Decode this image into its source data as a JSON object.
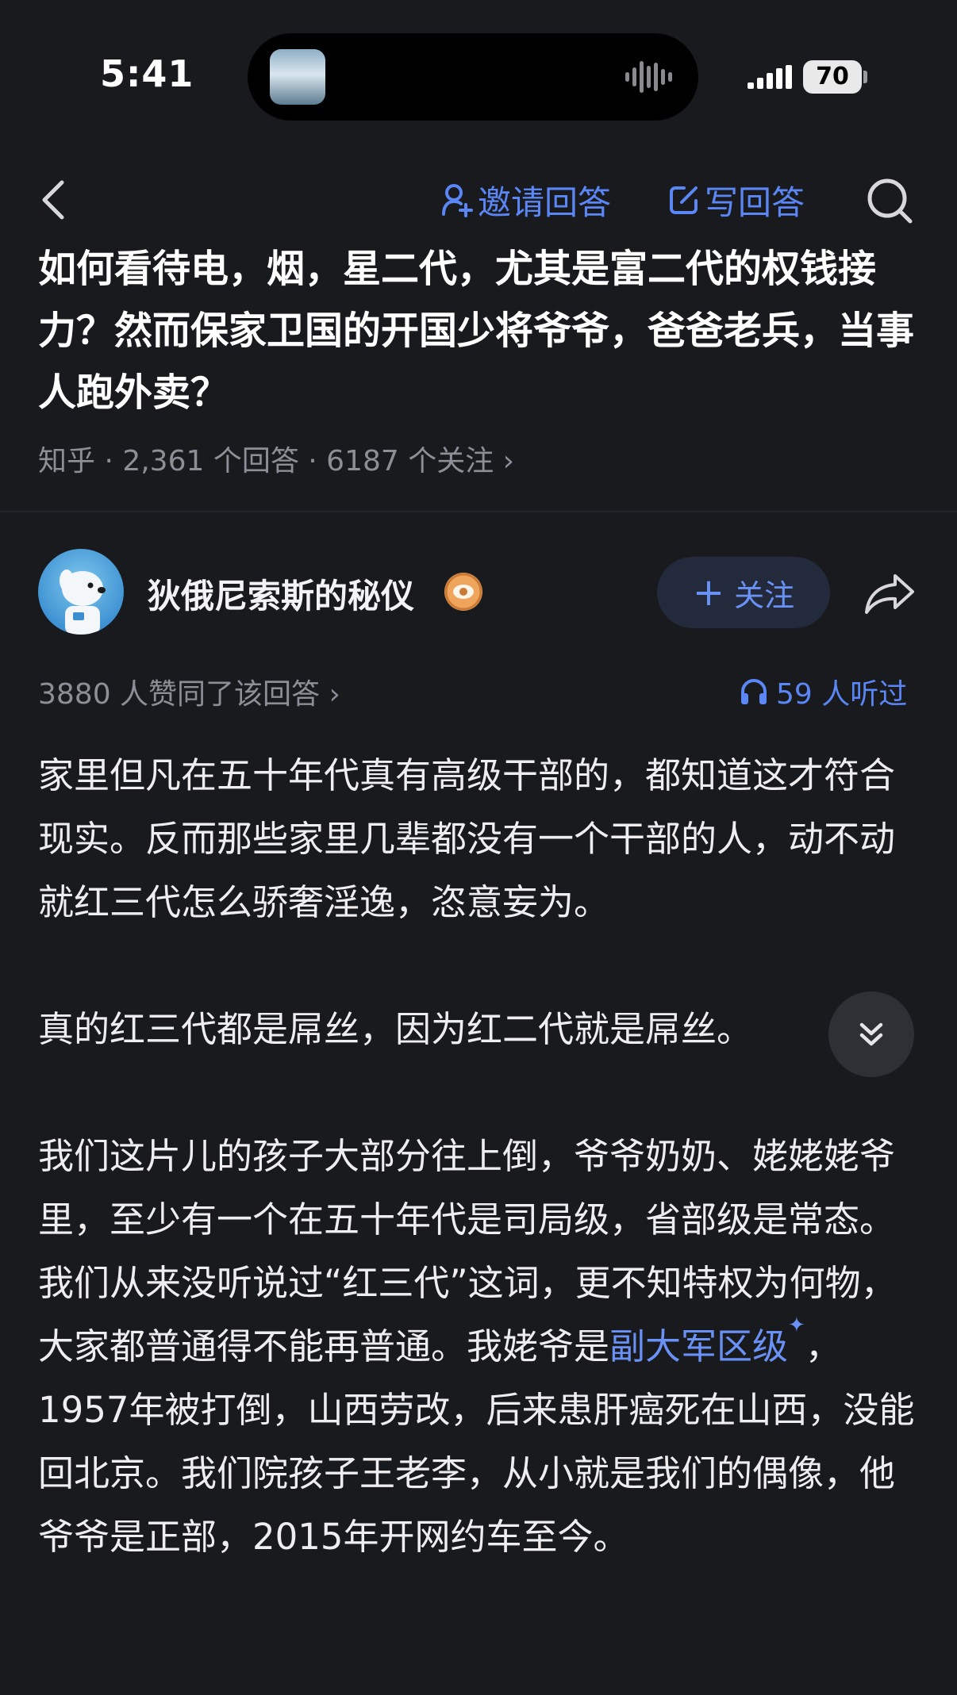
{
  "status": {
    "time": "5:41",
    "battery": "70"
  },
  "nav": {
    "invite_label": "邀请回答",
    "write_label": "写回答"
  },
  "question": {
    "title": "如何看待电，烟，星二代，尤其是富二代的权钱接力？然而保家卫国的开国少将爷爷，爸爸老兵，当事人跑外卖？",
    "meta": "知乎 · 2,361 个回答 · 6187 个关注 ›"
  },
  "answer": {
    "author_name": "狄俄尼索斯的秘仪",
    "follow_label": "关注",
    "follow_plus": "+",
    "agree_text": "3880 人赞同了该回答 ›",
    "listen_text": "59 人听过",
    "paragraphs": {
      "p1": "家里但凡在五十年代真有高级干部的，都知道这才符合现实。反而那些家里几辈都没有一个干部的人，动不动就红三代怎么骄奢淫逸，恣意妄为。",
      "p2": "真的红三代都是屌丝，因为红二代就是屌丝。",
      "p3_before_link": "我们这片儿的孩子大部分往上倒，爷爷奶奶、姥姥姥爷里，至少有一个在五十年代是司局级，省部级是常态。我们从来没听说过“红三代”这词，更不知特权为何物，大家都普通得不能再普通。我姥爷是",
      "p3_link": "副大军区级",
      "p3_link_mark": "✦",
      "p3_after_link": "，1957年被打倒，山西劳改，后来患肝癌死在山西，没能回北京。我们院孩子王老李，从小就是我们的偶像，他爷爷是正部，2015年开网约车至今。"
    }
  },
  "colors": {
    "background": "#191a1e",
    "accent": "#5b86f5",
    "muted": "#8d8e96"
  },
  "icons": [
    "back-icon",
    "invite-person-icon",
    "edit-icon",
    "search-icon",
    "badge-eye-icon",
    "share-icon",
    "headphones-icon",
    "double-chevron-down-icon"
  ]
}
